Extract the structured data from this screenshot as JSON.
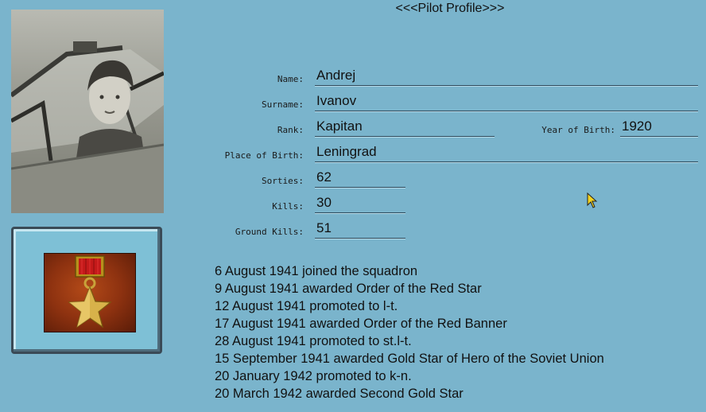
{
  "window": {
    "title": "<<<Pilot Profile>>>"
  },
  "profile": {
    "name_label": "Name:",
    "name": "Andrej",
    "surname_label": "Surname:",
    "surname": "Ivanov",
    "rank_label": "Rank:",
    "rank": "Kapitan",
    "year_label": "Year of Birth:",
    "year": "1920",
    "place_label": "Place of Birth:",
    "place": "Leningrad",
    "sorties_label": "Sorties:",
    "sorties": "62",
    "kills_label": "Kills:",
    "kills": "30",
    "ground_label": "Ground Kills:",
    "ground_kills": "51"
  },
  "history": [
    "6 August 1941 joined the squadron",
    "9 August 1941 awarded Order of the Red Star",
    "12 August 1941 promoted to l-t.",
    "17 August 1941 awarded Order of the Red Banner",
    "28 August 1941 promoted to st.l-t.",
    "15 September 1941 awarded Gold Star of Hero of the Soviet Union",
    "20 January 1942 promoted to k-n.",
    "20 March 1942 awarded Second Gold Star"
  ],
  "icons": {
    "photo": "pilot-photo",
    "medal": "gold-star-medal-icon",
    "cursor": "mouse-cursor-icon"
  },
  "colors": {
    "background": "#7ab4cc",
    "medal_bg": "#8e3210",
    "ribbon": "#c41a1a",
    "star": "#d8b24a"
  }
}
